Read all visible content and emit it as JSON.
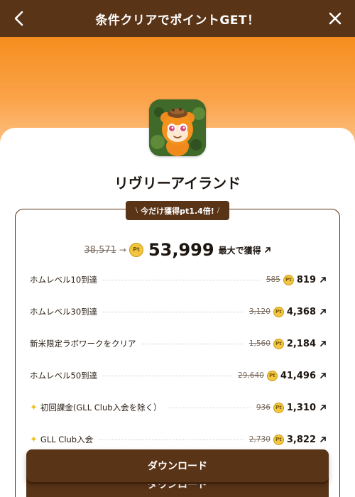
{
  "header": {
    "title": "条件クリアでポイントGET！"
  },
  "app": {
    "name": "リヴリーアイランド"
  },
  "badge": {
    "left": "\\",
    "text": "今だけ獲得pt1.4倍!",
    "right": "/"
  },
  "total": {
    "old": "38,571",
    "arrow": "→",
    "pt_icon": "Pt",
    "new": "53,999",
    "suffix": "最大で獲得"
  },
  "tasks": [
    {
      "label": "ホムレベル10到達",
      "old": "585",
      "value": "819",
      "sparkle": false
    },
    {
      "label": "ホムレベル30到達",
      "old": "3,120",
      "value": "4,368",
      "sparkle": false
    },
    {
      "label": "新米限定ラボワークをクリア",
      "old": "1,560",
      "value": "2,184",
      "sparkle": false
    },
    {
      "label": "ホムレベル50到達",
      "old": "29,640",
      "value": "41,496",
      "sparkle": false
    },
    {
      "label": "初回課金(GLL Club入会を除く）",
      "old": "936",
      "value": "1,310",
      "sparkle": true
    },
    {
      "label": "GLL Club入会",
      "old": "2,730",
      "value": "3,822",
      "sparkle": true
    }
  ],
  "download": {
    "label": "ダウンロード"
  },
  "icons": {
    "back": "chevron-left-icon",
    "close": "close-icon",
    "external": "arrow-up-right-icon",
    "sparkle": "sparkle-icon"
  },
  "colors": {
    "brand_brown": "#5a3417",
    "hero_orange": "#f58e1e",
    "pt_gold": "#f2c640"
  }
}
